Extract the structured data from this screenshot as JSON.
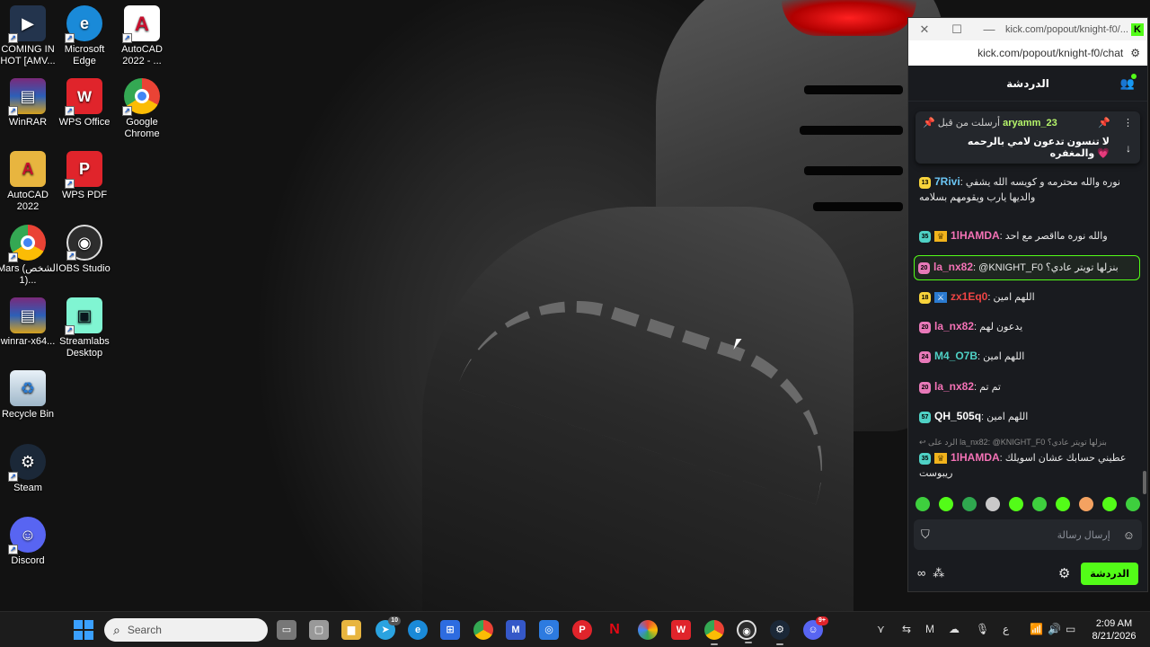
{
  "desktop": {
    "icons": [
      {
        "label": "COMING IN HOT [AMV...",
        "icon": "video-file-icon",
        "color": "#23344d"
      },
      {
        "label": "Microsoft Edge",
        "icon": "edge-icon",
        "color": "#1a8ad8"
      },
      {
        "label": "AutoCAD 2022 - ...",
        "icon": "autocad-icon",
        "color": "#c8102e"
      },
      {
        "label": "WinRAR",
        "icon": "winrar-icon",
        "color": "#7b2a7a"
      },
      {
        "label": "WPS Office",
        "icon": "wps-office-icon",
        "color": "#e0242b"
      },
      {
        "label": "Google Chrome",
        "icon": "chrome-icon",
        "color": "#4285f4"
      },
      {
        "label": "AutoCAD 2022",
        "icon": "autocad-folder-icon",
        "color": "#e8b53f"
      },
      {
        "label": "WPS PDF",
        "icon": "wps-pdf-icon",
        "color": "#e0242b"
      },
      {
        "label": "Mars (الشخص 1)...",
        "icon": "chrome-profile-icon",
        "color": "#4285f4"
      },
      {
        "label": "OBS Studio",
        "icon": "obs-icon",
        "color": "#2d2d2d"
      },
      {
        "label": "winrar-x64...",
        "icon": "winrar-installer-icon",
        "color": "#7b2a7a"
      },
      {
        "label": "Streamlabs Desktop",
        "icon": "streamlabs-icon",
        "color": "#80f5d2"
      },
      {
        "label": "Recycle Bin",
        "icon": "recycle-bin-icon",
        "color": "#9fb7c9"
      },
      {
        "label": "Steam",
        "icon": "steam-icon",
        "color": "#1b2838"
      },
      {
        "label": "Discord",
        "icon": "discord-icon",
        "color": "#5865f2"
      }
    ]
  },
  "chat_window": {
    "titlebar_url": "kick.com/popout/knight-f0/...",
    "address": "kick.com/popout/knight-f0/chat",
    "header_title": "الدردشة",
    "pinned": {
      "sent_by_label": "أرسلت من قبل",
      "user": "aryamm_23",
      "text": "لا تنسون تدعون لامي بالرحمه والمغفره 💗"
    },
    "messages": [
      {
        "badge": "13",
        "badge_color": "#f7d33b",
        "user": "7Rivi",
        "user_color": "#6bc6f5",
        "text": "نوره والله محترمه و كويسه الله يشفي والديها يارب ويقومهم بسلامه",
        "crown": false
      },
      {
        "badge": "35",
        "badge_color": "#4fd1c5",
        "user": "1lHAMDA",
        "user_color": "#f472b6",
        "text": "والله نوره مااقصر مع احد",
        "crown": true
      },
      {
        "badge": "20",
        "badge_color": "#e879b9",
        "user": "la_nx82",
        "user_color": "#f472b6",
        "text": "@KNIGHT_F0 بنزلها تويتر عادي؟",
        "crown": false,
        "highlight": true
      },
      {
        "badge": "18",
        "badge_color": "#f7d33b",
        "user": "zx1Eq0",
        "user_color": "#ef4444",
        "text": "اللهم امين",
        "crown": false
      },
      {
        "badge": "20",
        "badge_color": "#e879b9",
        "user": "la_nx82",
        "user_color": "#f472b6",
        "text": "يدعون لهم",
        "crown": false
      },
      {
        "badge": "24",
        "badge_color": "#e879b9",
        "user": "M4_O7B",
        "user_color": "#4fd1c5",
        "text": "اللهم امين",
        "crown": false
      },
      {
        "badge": "20",
        "badge_color": "#e879b9",
        "user": "la_nx82",
        "user_color": "#f472b6",
        "text": "تم تم",
        "crown": false
      },
      {
        "badge": "57",
        "badge_color": "#4fd1c5",
        "user": "QH_505q",
        "user_color": "#ffffff",
        "text": "اللهم امين",
        "crown": false
      },
      {
        "reply": "الرد على la_nx82: @KNIGHT_F0 بنزلها تويتر عادي؟",
        "badge": "35",
        "badge_color": "#4fd1c5",
        "user": "1lHAMDA",
        "user_color": "#f472b6",
        "text": "عطيني حسابك عشان اسويلك ريبوست",
        "crown": true
      }
    ],
    "emotes": [
      "#3ecf3e",
      "#53fc18",
      "#2fa84f",
      "#c9c9c9",
      "#53fc18",
      "#3ecf3e",
      "#53fc18",
      "#f4a261",
      "#53fc18",
      "#3ecf3e"
    ],
    "input_placeholder": "إرسال رسالة",
    "send_label": "الدردشة"
  },
  "taskbar": {
    "search_placeholder": "Search",
    "telegram_badge": "10",
    "discord_badge": "9+",
    "tray_lang": "ع",
    "time": "2:09 AM",
    "date": "8/21/2026"
  }
}
